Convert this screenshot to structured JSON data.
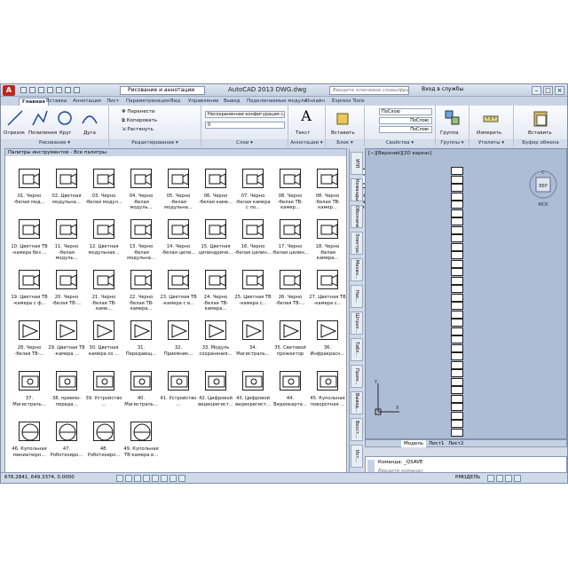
{
  "app": {
    "logo": "A",
    "title": "AutoCAD 2013   DWG.dwg",
    "workspace": "Рисование и аннотации",
    "search_placeholder": "Введите ключевое слово/фразу",
    "signin": "Вход в службы"
  },
  "tabs": [
    "Главная",
    "Вставка",
    "Аннотации",
    "Лист",
    "Параметризация",
    "Вид",
    "Управление",
    "Вывод",
    "Подключаемые модули",
    "Онлайн",
    "Express Tools"
  ],
  "ribbon": {
    "draw": {
      "label": "Рисование ▾",
      "tools": [
        "Отрезок",
        "Полилиния",
        "Круг",
        "Дуга"
      ]
    },
    "modify": {
      "label": "Редактирование ▾",
      "tools": [
        "Перенести",
        "Копировать",
        "Растянуть"
      ]
    },
    "layers": {
      "label": "Слои ▾",
      "combo1": "Несохраненная конфигурация сло",
      "combo2": "0"
    },
    "annot": {
      "label": "Аннотации ▾",
      "tools": [
        "Текст"
      ]
    },
    "block": {
      "label": "Блок ▾",
      "tools": [
        "Вставить"
      ]
    },
    "props": {
      "label": "Свойства ▾",
      "c1": "ПоСлою",
      "c2": "ПоСлою",
      "c3": "ПоСлою"
    },
    "groups": {
      "label": "Группы ▾",
      "tools": [
        "Группа"
      ]
    },
    "util": {
      "label": "Утилиты ▾",
      "tools": [
        "Измерить"
      ]
    },
    "clip": {
      "label": "Буфер обмена",
      "tools": [
        "Вставить"
      ]
    }
  },
  "palette": {
    "title": "Палитры инструментов - Все палитры",
    "tools": [
      "01. Черно -белая мод...",
      "02. Цветная модульна...",
      "03. Черно -белая модул...",
      "04. Черно -белая модуль...",
      "05. Черно -белая модульна...",
      "06. Черно -белая каме...",
      "07. Черно -белая камера с по...",
      "08. Черно -белая ТВ-камер...",
      "08. Черно -белая ТВ-камер...",
      "09. Черно -белая ТВ-камер...",
      "10. Цветная ТВ -камера без ...",
      "11. Черно -белая модуль...",
      "12. Цветная модульная...",
      "13. Черно -белая модульна...",
      "14. Черно -белая цили...",
      "15. Цветная цилиндриче...",
      "16. Черно -белая цилин...",
      "17. Черно -белая цилин...",
      "18. Черно -белая камера...",
      "19. Цветная ТВ -камера с ф...",
      "20. Черно -белая ТВ-...",
      "21. Черно -белая ТВ-каме...",
      "22. Черно -белая ТВ-камера...",
      "23. Цветная ТВ -камера с в...",
      "24. Черно -белая ТВ-камера...",
      "25. Цветная ТВ -камера с...",
      "26. Черно -белая ТВ-...",
      "27. Цветная ТВ -камера с...",
      "28. Черно -белая ТВ-...",
      "29. Цветная ТВ -камера ...",
      "30. Цветная камера со ...",
      "31. Передающ...",
      "32. Приемник...",
      "33. Модуль сохранения...",
      "34. Магистраль...",
      "35. Световой прожектор",
      "36. Инфракрасн...",
      "37. Магистраль...",
      "38. приемо-переда...",
      "39. Устройство ...",
      "40. Магистраль...",
      "41. Устройство ...",
      "42. Цифровой видеорегист...",
      "43. Цифровой видеорегист...",
      "44. Видеокарта...",
      "45. Купольная поворотная ...",
      "46. Купольная миниатюрн...",
      "47. Роботизиро...",
      "48. Роботизиро...",
      "49. Купольная ТВ-камера в..."
    ]
  },
  "vtabs": [
    "УПП Общие",
    "Команды",
    "Обозначения",
    "Электро",
    "Механ...",
    "Нас...",
    "Штрих...",
    "Табл...",
    "Прим...",
    "Вывод...",
    "Восст...",
    "Ист..."
  ],
  "viewport": {
    "label": "[−][Верхний][2D каркас]",
    "cube_label": "ВЕР",
    "cube_top": "С",
    "wcs": "МСК"
  },
  "layout_tabs": [
    "Модель",
    "Лист1",
    "Лист2"
  ],
  "cmdline": {
    "history": "Команда:  _QSAVE",
    "prompt": "Введите команду"
  },
  "status": {
    "coords": "676.2841, 649.3374, 0.0000",
    "model": "РМОДЕЛЬ"
  },
  "colors": {
    "accent": "#c0271b",
    "ribbon_bg": "#e0e7f1",
    "viewport_bg": "#aebdd6"
  }
}
